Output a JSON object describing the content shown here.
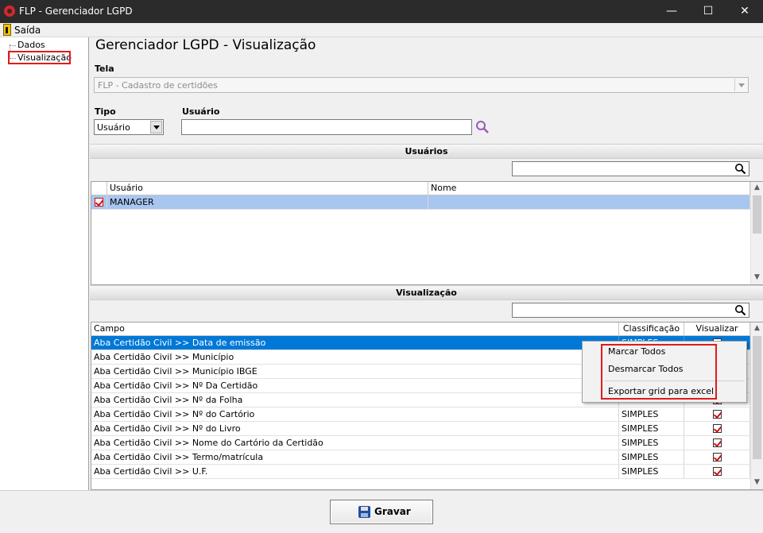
{
  "window": {
    "title": "FLP - Gerenciador LGPD",
    "minimize": "—",
    "maximize": "☐",
    "close": "✕"
  },
  "menu": {
    "exit_label": "Saída"
  },
  "tree": {
    "items": [
      {
        "label": "Dados"
      },
      {
        "label": "Visualização"
      }
    ]
  },
  "page_title": "Gerenciador LGPD - Visualização",
  "tela": {
    "label": "Tela",
    "value": "FLP - Cadastro de certidões"
  },
  "tipo": {
    "label": "Tipo",
    "value": "Usuário"
  },
  "usuario_filter": {
    "label": "Usuário",
    "value": ""
  },
  "users_section": {
    "title": "Usuários",
    "search_value": "",
    "columns": [
      "Usuário",
      "Nome"
    ],
    "rows": [
      {
        "checked": true,
        "usuario": "MANAGER",
        "nome": ""
      }
    ]
  },
  "view_section": {
    "title": "Visualização",
    "search_value": "",
    "columns": [
      "Campo",
      "Classificação",
      "Visualizar"
    ],
    "rows": [
      {
        "campo": "Aba Certidão Civil >> Data de emissão",
        "classificacao": "SIMPLES",
        "visualizar": true
      },
      {
        "campo": "Aba Certidão Civil >> Município",
        "classificacao": "SIMPLES",
        "visualizar": true
      },
      {
        "campo": "Aba Certidão Civil >> Município IBGE",
        "classificacao": "SIMPLES",
        "visualizar": true
      },
      {
        "campo": "Aba Certidão Civil >> Nº Da Certidão",
        "classificacao": "SIMPLES",
        "visualizar": true
      },
      {
        "campo": "Aba Certidão Civil >> Nº da Folha",
        "classificacao": "SIMPLES",
        "visualizar": true
      },
      {
        "campo": "Aba Certidão Civil >> Nº do Cartório",
        "classificacao": "SIMPLES",
        "visualizar": true
      },
      {
        "campo": "Aba Certidão Civil >> Nº do Livro",
        "classificacao": "SIMPLES",
        "visualizar": true
      },
      {
        "campo": "Aba Certidão Civil >> Nome do Cartório da Certidão",
        "classificacao": "SIMPLES",
        "visualizar": true
      },
      {
        "campo": "Aba Certidão Civil >> Termo/matrícula",
        "classificacao": "SIMPLES",
        "visualizar": true
      },
      {
        "campo": "Aba Certidão Civil >> U.F.",
        "classificacao": "SIMPLES",
        "visualizar": true
      }
    ]
  },
  "context_menu": {
    "items": [
      "Marcar Todos",
      "Desmarcar Todos",
      "Exportar grid para excel"
    ]
  },
  "save_button": {
    "label": "Gravar"
  },
  "colors": {
    "selection": "#0078d7",
    "highlight_box": "#e01b1b",
    "check": "#d01010",
    "search_icon": "#9b59b6"
  },
  "icons": {
    "app": "flp-logo-icon",
    "exit": "exit-door-icon",
    "search": "magnifier-icon",
    "save": "floppy-disk-icon"
  }
}
